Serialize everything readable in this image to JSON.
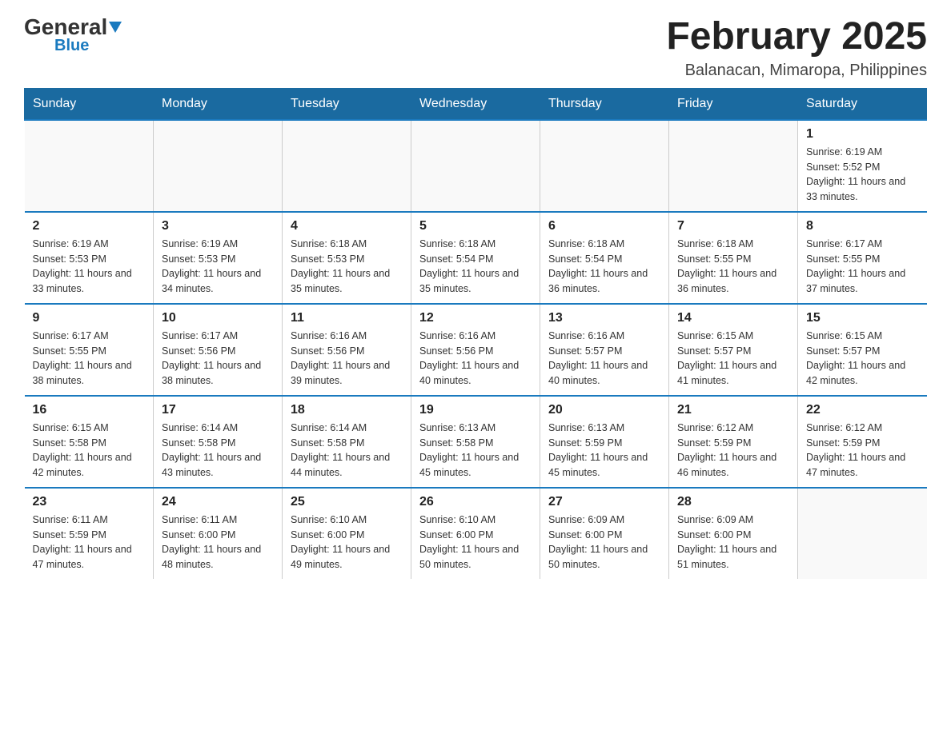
{
  "logo": {
    "general": "General",
    "blue": "Blue"
  },
  "title": "February 2025",
  "subtitle": "Balanacan, Mimaropa, Philippines",
  "days_of_week": [
    "Sunday",
    "Monday",
    "Tuesday",
    "Wednesday",
    "Thursday",
    "Friday",
    "Saturday"
  ],
  "weeks": [
    [
      {
        "day": "",
        "info": ""
      },
      {
        "day": "",
        "info": ""
      },
      {
        "day": "",
        "info": ""
      },
      {
        "day": "",
        "info": ""
      },
      {
        "day": "",
        "info": ""
      },
      {
        "day": "",
        "info": ""
      },
      {
        "day": "1",
        "info": "Sunrise: 6:19 AM\nSunset: 5:52 PM\nDaylight: 11 hours and 33 minutes."
      }
    ],
    [
      {
        "day": "2",
        "info": "Sunrise: 6:19 AM\nSunset: 5:53 PM\nDaylight: 11 hours and 33 minutes."
      },
      {
        "day": "3",
        "info": "Sunrise: 6:19 AM\nSunset: 5:53 PM\nDaylight: 11 hours and 34 minutes."
      },
      {
        "day": "4",
        "info": "Sunrise: 6:18 AM\nSunset: 5:53 PM\nDaylight: 11 hours and 35 minutes."
      },
      {
        "day": "5",
        "info": "Sunrise: 6:18 AM\nSunset: 5:54 PM\nDaylight: 11 hours and 35 minutes."
      },
      {
        "day": "6",
        "info": "Sunrise: 6:18 AM\nSunset: 5:54 PM\nDaylight: 11 hours and 36 minutes."
      },
      {
        "day": "7",
        "info": "Sunrise: 6:18 AM\nSunset: 5:55 PM\nDaylight: 11 hours and 36 minutes."
      },
      {
        "day": "8",
        "info": "Sunrise: 6:17 AM\nSunset: 5:55 PM\nDaylight: 11 hours and 37 minutes."
      }
    ],
    [
      {
        "day": "9",
        "info": "Sunrise: 6:17 AM\nSunset: 5:55 PM\nDaylight: 11 hours and 38 minutes."
      },
      {
        "day": "10",
        "info": "Sunrise: 6:17 AM\nSunset: 5:56 PM\nDaylight: 11 hours and 38 minutes."
      },
      {
        "day": "11",
        "info": "Sunrise: 6:16 AM\nSunset: 5:56 PM\nDaylight: 11 hours and 39 minutes."
      },
      {
        "day": "12",
        "info": "Sunrise: 6:16 AM\nSunset: 5:56 PM\nDaylight: 11 hours and 40 minutes."
      },
      {
        "day": "13",
        "info": "Sunrise: 6:16 AM\nSunset: 5:57 PM\nDaylight: 11 hours and 40 minutes."
      },
      {
        "day": "14",
        "info": "Sunrise: 6:15 AM\nSunset: 5:57 PM\nDaylight: 11 hours and 41 minutes."
      },
      {
        "day": "15",
        "info": "Sunrise: 6:15 AM\nSunset: 5:57 PM\nDaylight: 11 hours and 42 minutes."
      }
    ],
    [
      {
        "day": "16",
        "info": "Sunrise: 6:15 AM\nSunset: 5:58 PM\nDaylight: 11 hours and 42 minutes."
      },
      {
        "day": "17",
        "info": "Sunrise: 6:14 AM\nSunset: 5:58 PM\nDaylight: 11 hours and 43 minutes."
      },
      {
        "day": "18",
        "info": "Sunrise: 6:14 AM\nSunset: 5:58 PM\nDaylight: 11 hours and 44 minutes."
      },
      {
        "day": "19",
        "info": "Sunrise: 6:13 AM\nSunset: 5:58 PM\nDaylight: 11 hours and 45 minutes."
      },
      {
        "day": "20",
        "info": "Sunrise: 6:13 AM\nSunset: 5:59 PM\nDaylight: 11 hours and 45 minutes."
      },
      {
        "day": "21",
        "info": "Sunrise: 6:12 AM\nSunset: 5:59 PM\nDaylight: 11 hours and 46 minutes."
      },
      {
        "day": "22",
        "info": "Sunrise: 6:12 AM\nSunset: 5:59 PM\nDaylight: 11 hours and 47 minutes."
      }
    ],
    [
      {
        "day": "23",
        "info": "Sunrise: 6:11 AM\nSunset: 5:59 PM\nDaylight: 11 hours and 47 minutes."
      },
      {
        "day": "24",
        "info": "Sunrise: 6:11 AM\nSunset: 6:00 PM\nDaylight: 11 hours and 48 minutes."
      },
      {
        "day": "25",
        "info": "Sunrise: 6:10 AM\nSunset: 6:00 PM\nDaylight: 11 hours and 49 minutes."
      },
      {
        "day": "26",
        "info": "Sunrise: 6:10 AM\nSunset: 6:00 PM\nDaylight: 11 hours and 50 minutes."
      },
      {
        "day": "27",
        "info": "Sunrise: 6:09 AM\nSunset: 6:00 PM\nDaylight: 11 hours and 50 minutes."
      },
      {
        "day": "28",
        "info": "Sunrise: 6:09 AM\nSunset: 6:00 PM\nDaylight: 11 hours and 51 minutes."
      },
      {
        "day": "",
        "info": ""
      }
    ]
  ]
}
